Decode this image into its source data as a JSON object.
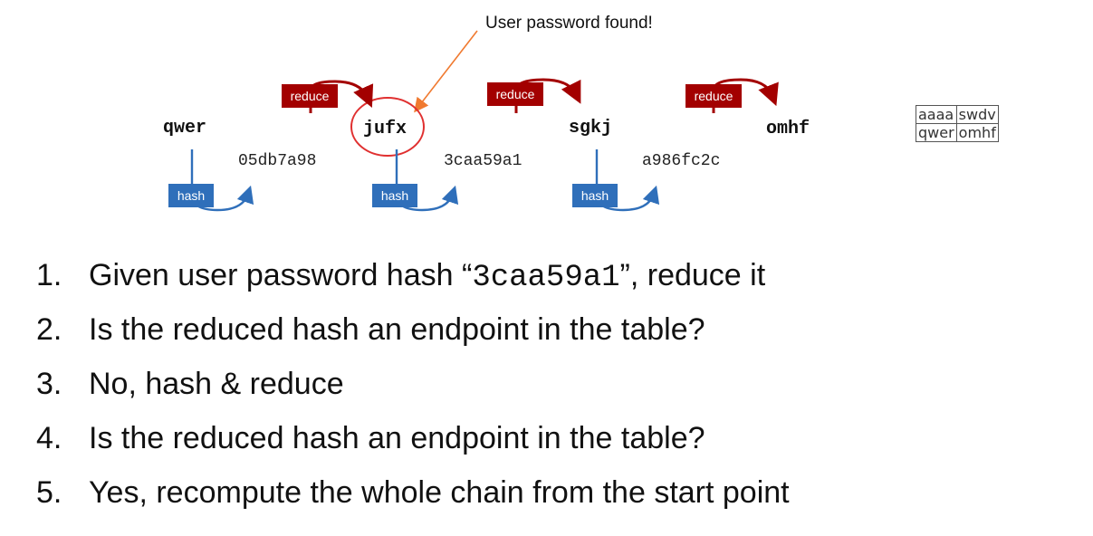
{
  "callout": "User password found!",
  "chain": {
    "words": [
      "qwer",
      "jufx",
      "sgkj",
      "omhf"
    ],
    "hashes": [
      "05db7a98",
      "3caa59a1",
      "a986fc2c"
    ],
    "hash_label": "hash",
    "reduce_label": "reduce",
    "found_word": "jufx"
  },
  "rainbow_table": [
    [
      "aaaa",
      "swdv"
    ],
    [
      "qwer",
      "omhf"
    ]
  ],
  "steps": [
    {
      "num": "1.",
      "pre": "Given user password hash “",
      "code": "3caa59a1",
      "post": "”, reduce it"
    },
    {
      "num": "2.",
      "text": "Is the reduced hash an endpoint in the table?"
    },
    {
      "num": "3.",
      "text": "No, hash & reduce"
    },
    {
      "num": "4.",
      "text": "Is the reduced hash an endpoint in the table?"
    },
    {
      "num": "5.",
      "text": "Yes, recompute the whole chain from the start point"
    }
  ],
  "colors": {
    "reduce": "#a30000",
    "hash": "#2f6fba",
    "highlight": "#e03030",
    "callout_arrow": "#f07a30"
  }
}
